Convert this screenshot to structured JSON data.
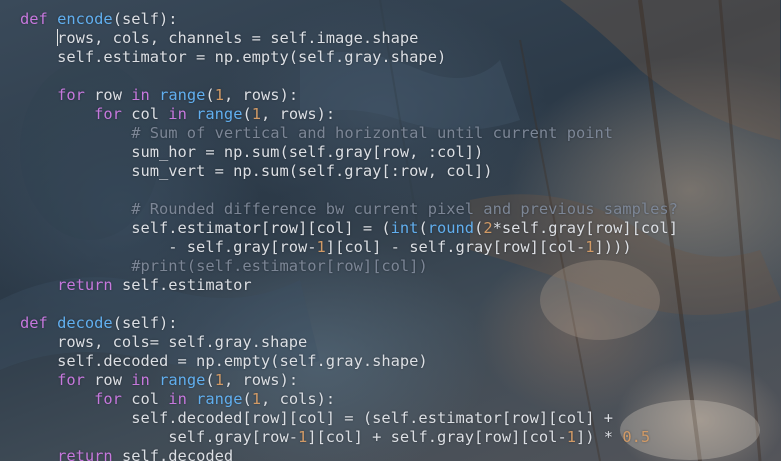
{
  "colors": {
    "keyword": "#c678dd",
    "function": "#61afef",
    "number": "#d19a66",
    "comment": "#7c8696",
    "text": "#dcdfe4"
  },
  "code_lines": [
    [
      {
        "t": "def",
        "c": "kw"
      },
      {
        "t": " "
      },
      {
        "t": "encode",
        "c": "fn"
      },
      {
        "t": "(self):"
      }
    ],
    [
      {
        "t": "    "
      },
      {
        "t": "CURSOR",
        "c": "cursor"
      },
      {
        "t": "rows, cols, channels = self.image.shape"
      }
    ],
    [
      {
        "t": "    self.estimator = np.empty(self.gray.shape)"
      }
    ],
    [],
    [
      {
        "t": "    "
      },
      {
        "t": "for",
        "c": "kw"
      },
      {
        "t": " row "
      },
      {
        "t": "in",
        "c": "kw"
      },
      {
        "t": " "
      },
      {
        "t": "range",
        "c": "fn"
      },
      {
        "t": "("
      },
      {
        "t": "1",
        "c": "num"
      },
      {
        "t": ", rows):"
      }
    ],
    [
      {
        "t": "        "
      },
      {
        "t": "for",
        "c": "kw"
      },
      {
        "t": " col "
      },
      {
        "t": "in",
        "c": "kw"
      },
      {
        "t": " "
      },
      {
        "t": "range",
        "c": "fn"
      },
      {
        "t": "("
      },
      {
        "t": "1",
        "c": "num"
      },
      {
        "t": ", rows):"
      }
    ],
    [
      {
        "t": "            "
      },
      {
        "t": "# Sum of vertical and horizontal until current point",
        "c": "cm"
      }
    ],
    [
      {
        "t": "            sum_hor = np.sum(self.gray[row, :col])"
      }
    ],
    [
      {
        "t": "            sum_vert = np.sum(self.gray[:row, col])"
      }
    ],
    [],
    [
      {
        "t": "            "
      },
      {
        "t": "# Rounded difference bw current pixel and previous samples?",
        "c": "cm"
      }
    ],
    [
      {
        "t": "            self.estimator[row][col] = ("
      },
      {
        "t": "int",
        "c": "fn"
      },
      {
        "t": "("
      },
      {
        "t": "round",
        "c": "fn"
      },
      {
        "t": "("
      },
      {
        "t": "2",
        "c": "num"
      },
      {
        "t": "*self.gray[row][col]"
      }
    ],
    [
      {
        "t": "                - self.gray[row-"
      },
      {
        "t": "1",
        "c": "num"
      },
      {
        "t": "][col] - self.gray[row][col-"
      },
      {
        "t": "1",
        "c": "num"
      },
      {
        "t": "])))"
      }
    ],
    [
      {
        "t": "            "
      },
      {
        "t": "#print(self.estimator[row][col])",
        "c": "cm"
      }
    ],
    [
      {
        "t": "    "
      },
      {
        "t": "return",
        "c": "kw"
      },
      {
        "t": " self.estimator"
      }
    ],
    [],
    [
      {
        "t": "def",
        "c": "kw"
      },
      {
        "t": " "
      },
      {
        "t": "decode",
        "c": "fn"
      },
      {
        "t": "(self):"
      }
    ],
    [
      {
        "t": "    rows, cols= self.gray.shape"
      }
    ],
    [
      {
        "t": "    self.decoded = np.empty(self.gray.shape)"
      }
    ],
    [
      {
        "t": "    "
      },
      {
        "t": "for",
        "c": "kw"
      },
      {
        "t": " row "
      },
      {
        "t": "in",
        "c": "kw"
      },
      {
        "t": " "
      },
      {
        "t": "range",
        "c": "fn"
      },
      {
        "t": "("
      },
      {
        "t": "1",
        "c": "num"
      },
      {
        "t": ", rows):"
      }
    ],
    [
      {
        "t": "        "
      },
      {
        "t": "for",
        "c": "kw"
      },
      {
        "t": " col "
      },
      {
        "t": "in",
        "c": "kw"
      },
      {
        "t": " "
      },
      {
        "t": "range",
        "c": "fn"
      },
      {
        "t": "("
      },
      {
        "t": "1",
        "c": "num"
      },
      {
        "t": ", cols):"
      }
    ],
    [
      {
        "t": "            self.decoded[row][col] = (self.estimator[row][col] +"
      }
    ],
    [
      {
        "t": "                self.gray[row-"
      },
      {
        "t": "1",
        "c": "num"
      },
      {
        "t": "][col] + self.gray[row][col-"
      },
      {
        "t": "1",
        "c": "num"
      },
      {
        "t": "]) * "
      },
      {
        "t": "0.5",
        "c": "num"
      }
    ],
    [
      {
        "t": "    "
      },
      {
        "t": "return",
        "c": "kw"
      },
      {
        "t": " self.decoded"
      }
    ]
  ]
}
